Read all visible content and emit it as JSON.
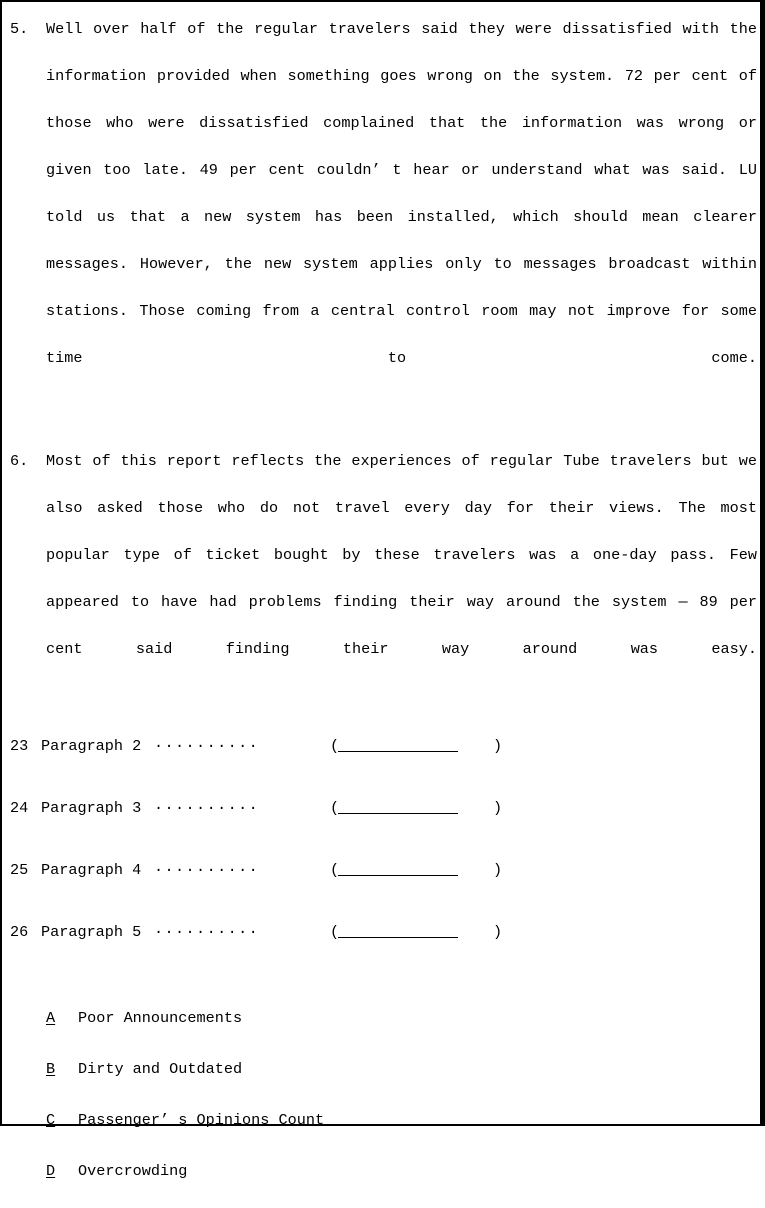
{
  "document": {
    "type": "exam-reading-page",
    "text_color": "#000000",
    "background_color": "#ffffff",
    "border_color": "#000000"
  },
  "paragraphs": [
    {
      "marker": "5.",
      "text": "Well over half of the regular travelers said they were dissatisfied with the information provided when something goes wrong on the system. 72 per cent of those who were dissatisfied complained that the information was wrong or given too late. 49 per cent couldn’ t hear or understand what was said. LU told us that a new system has been installed, which should mean clearer messages. However, the new system applies only to messages broadcast within stations. Those coming from a central control room may not improve for some time to come."
    },
    {
      "marker": "6.",
      "text": "Most of this report reflects the experiences of regular Tube travelers but we also asked those who do not travel every day for their views. The most popular type of ticket bought by these travelers was a one-day pass. Few appeared to have had problems finding their way around the system — 89 per cent said finding their way around was easy."
    }
  ],
  "match_items": [
    {
      "number": "23",
      "label": "Paragraph 2",
      "leader": "··········",
      "paren_open": "(",
      "answer": "",
      "paren_close": ")"
    },
    {
      "number": "24",
      "label": "Paragraph 3",
      "leader": "··········",
      "paren_open": "(",
      "answer": "",
      "paren_close": ")"
    },
    {
      "number": "25",
      "label": "Paragraph 4",
      "leader": "··········",
      "paren_open": "(",
      "answer": "",
      "paren_close": ")"
    },
    {
      "number": "26",
      "label": "Paragraph 5",
      "leader": "··········",
      "paren_open": "(",
      "answer": "",
      "paren_close": ")"
    }
  ],
  "options": [
    {
      "letter": "A",
      "text": "Poor Announcements"
    },
    {
      "letter": "B",
      "text": "Dirty and Outdated"
    },
    {
      "letter": "C",
      "text": "Passenger’ s Opinions Count"
    },
    {
      "letter": "D",
      "text": "Overcrowding"
    }
  ]
}
